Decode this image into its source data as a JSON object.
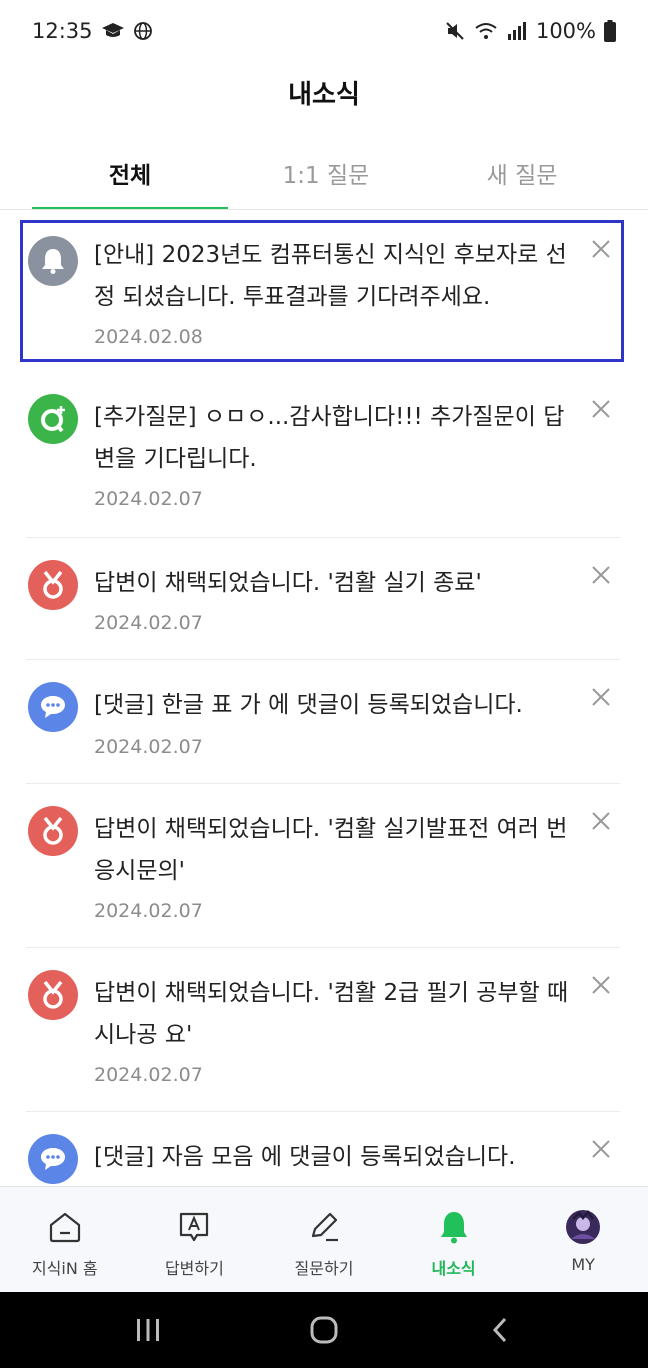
{
  "status_bar": {
    "time": "12:35",
    "battery": "100%",
    "icons": [
      "graduation-cap-icon",
      "globe-icon",
      "mute-icon",
      "wifi-icon",
      "signal-icon",
      "battery-icon"
    ]
  },
  "header": {
    "title": "내소식"
  },
  "tabs": [
    {
      "label": "전체",
      "active": true
    },
    {
      "label": "1:1 질문",
      "active": false
    },
    {
      "label": "새 질문",
      "active": false
    }
  ],
  "notifications": [
    {
      "type": "notice",
      "icon": "bell-icon",
      "color": "#8a929f",
      "text": "[안내] 2023년도 컴퓨터통신 지식인 후보자로 선정 되셨습니다. 투표결과를 기다려주세요.",
      "date": "2024.02.08"
    },
    {
      "type": "additional-question",
      "icon": "q-plus-icon",
      "color": "#3bb54a",
      "text": "[추가질문] ㅇㅁㅇ...감사합니다!!! 추가질문이 답변을 기다립니다.",
      "date": "2024.02.07"
    },
    {
      "type": "answer-selected",
      "icon": "medal-icon",
      "color": "#e4615b",
      "text": "답변이 채택되었습니다. '컴활 실기 종료'",
      "date": "2024.02.07"
    },
    {
      "type": "comment",
      "icon": "speech-bubble-icon",
      "color": "#5b86e8",
      "text": "[댓글] 한글 표 가 에 댓글이 등록되었습니다.",
      "date": "2024.02.07"
    },
    {
      "type": "answer-selected",
      "icon": "medal-icon",
      "color": "#e4615b",
      "text": "답변이 채택되었습니다. '컴활 실기발표전 여러 번 응시문의'",
      "date": "2024.02.07"
    },
    {
      "type": "answer-selected",
      "icon": "medal-icon",
      "color": "#e4615b",
      "text": "답변이 채택되었습니다. '컴활 2급 필기 공부할 때 시나공 요'",
      "date": "2024.02.07"
    },
    {
      "type": "comment",
      "icon": "speech-bubble-icon",
      "color": "#5b86e8",
      "text": "[댓글] 자음 모음 에 댓글이 등록되었습니다.",
      "date": ""
    }
  ],
  "bottom_nav": [
    {
      "label": "지식iN 홈",
      "icon": "home-icon"
    },
    {
      "label": "답변하기",
      "icon": "answer-icon"
    },
    {
      "label": "질문하기",
      "icon": "pencil-icon"
    },
    {
      "label": "내소식",
      "icon": "bell-icon",
      "active": true
    },
    {
      "label": "MY",
      "icon": "profile-avatar-icon"
    }
  ],
  "colors": {
    "accent": "#22c05a",
    "selection_outline": "#2f35c9"
  }
}
